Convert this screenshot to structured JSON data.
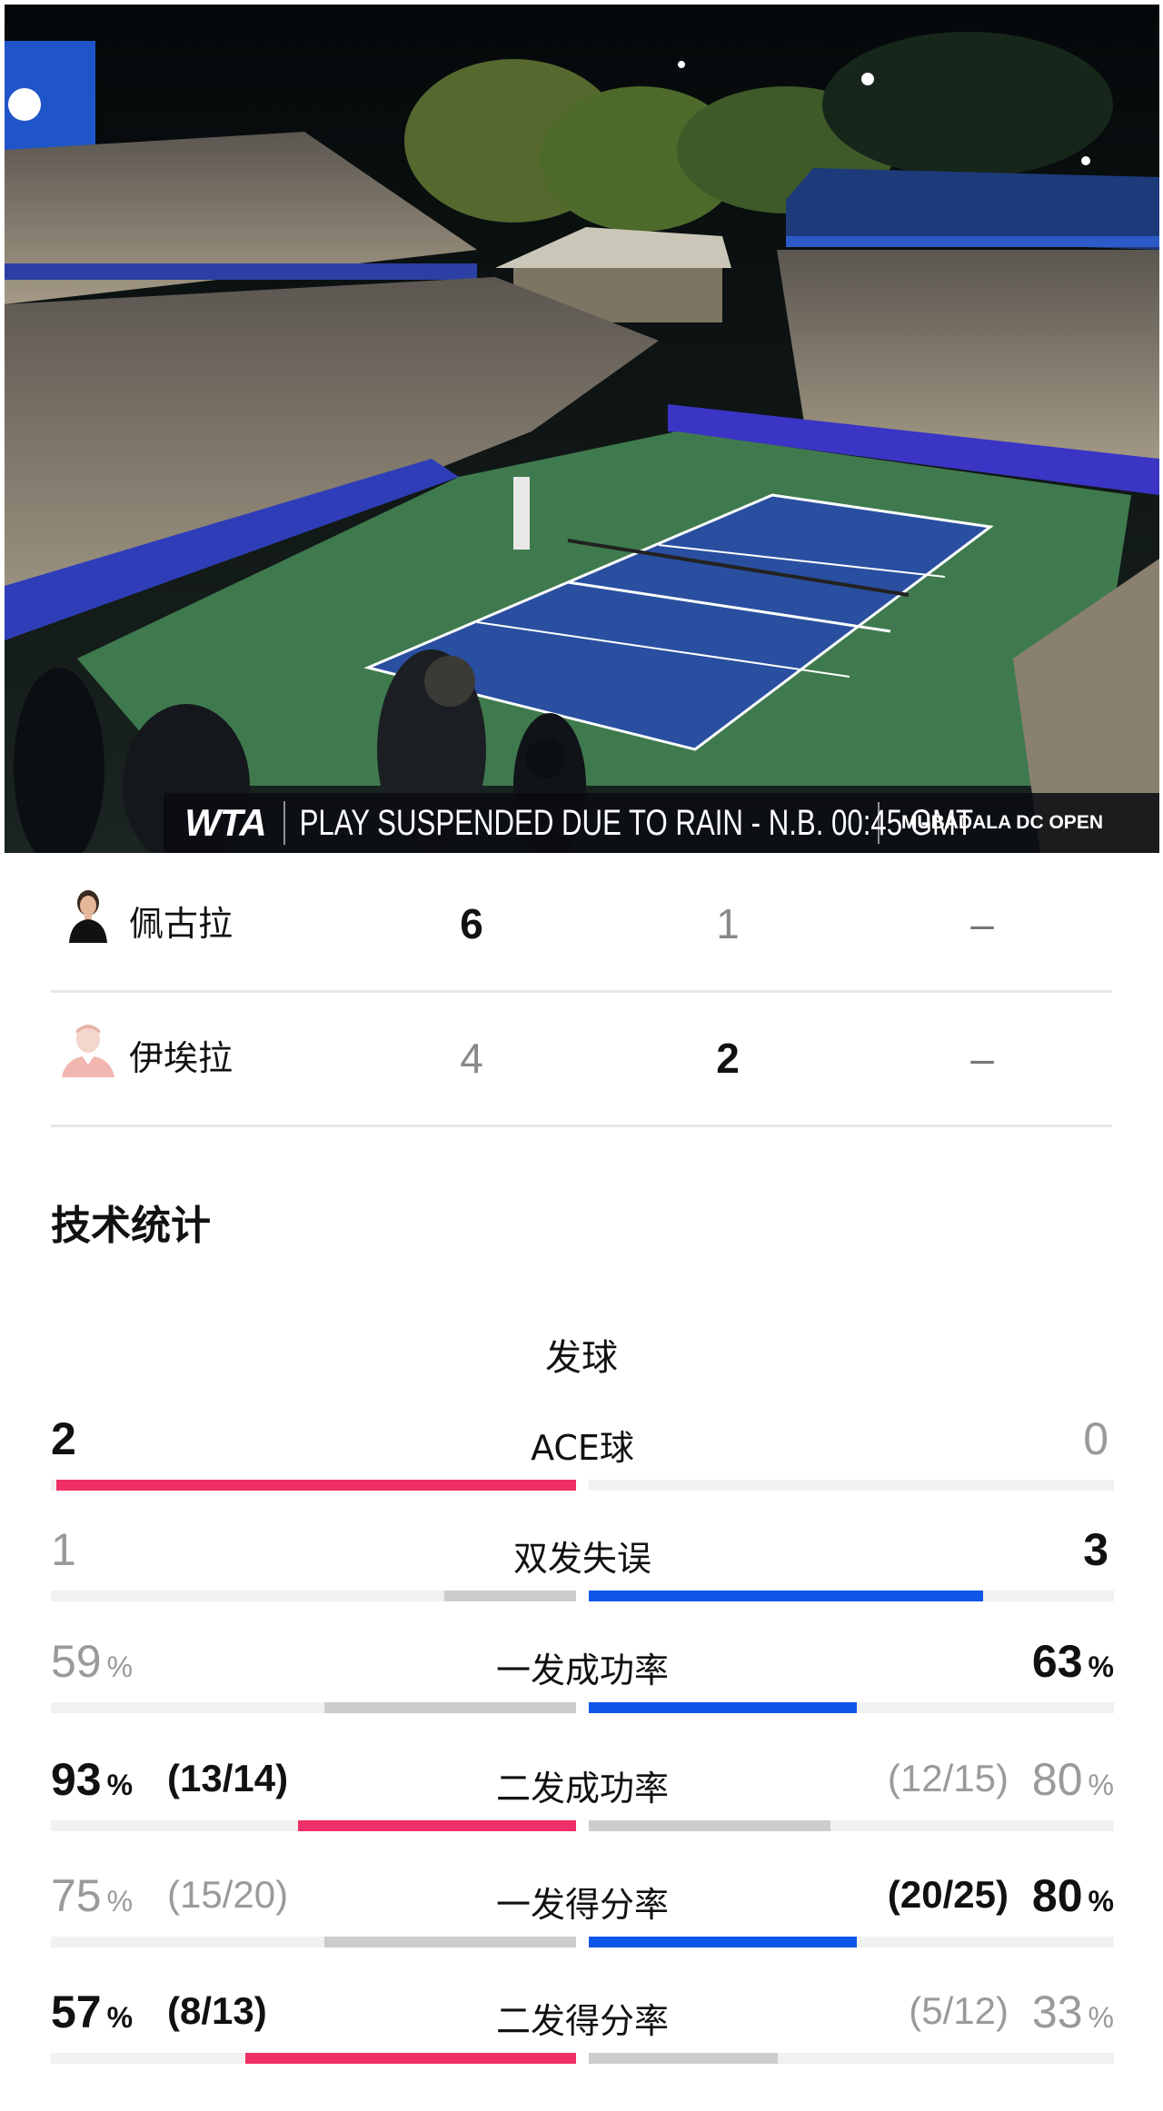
{
  "banner": {
    "logo": "WTA",
    "message": "PLAY SUSPENDED DUE TO RAIN - N.B. 00:45 GMT",
    "tournament": "MUBADALA DC OPEN"
  },
  "players": [
    {
      "name": "佩古拉",
      "sets": [
        "6",
        "1",
        "–"
      ],
      "avatar": "player-photo-icon"
    },
    {
      "name": "伊埃拉",
      "sets": [
        "4",
        "2",
        "–"
      ],
      "avatar": "player-placeholder-icon"
    }
  ],
  "stats_title": "技术统计",
  "serve_section": "发球",
  "stats": [
    {
      "label": "ACE球",
      "left": "2",
      "right": "0",
      "left_pct": "",
      "right_pct": "",
      "left_frac": "",
      "right_frac": "",
      "left_fill": 0.99,
      "right_fill": 0.0,
      "left_color": "#ef2f68",
      "right_color": "#cccccc",
      "winner": "left"
    },
    {
      "label": "双发失误",
      "left": "1",
      "right": "3",
      "left_pct": "",
      "right_pct": "",
      "left_frac": "",
      "right_frac": "",
      "left_fill": 0.25,
      "right_fill": 0.75,
      "left_color": "#cccccc",
      "right_color": "#0f55e8",
      "winner": "right"
    },
    {
      "label": "一发成功率",
      "left": "59",
      "right": "63",
      "left_pct": "%",
      "right_pct": "%",
      "left_frac": "",
      "right_frac": "",
      "left_fill": 0.48,
      "right_fill": 0.51,
      "left_color": "#cccccc",
      "right_color": "#0f55e8",
      "winner": "right"
    },
    {
      "label": "二发成功率",
      "left": "93",
      "right": "80",
      "left_pct": "%",
      "right_pct": "%",
      "left_frac": "(13/14)",
      "right_frac": "(12/15)",
      "left_fill": 0.53,
      "right_fill": 0.46,
      "left_color": "#ef2f68",
      "right_color": "#cccccc",
      "winner": "left"
    },
    {
      "label": "一发得分率",
      "left": "75",
      "right": "80",
      "left_pct": "%",
      "right_pct": "%",
      "left_frac": "(15/20)",
      "right_frac": "(20/25)",
      "left_fill": 0.48,
      "right_fill": 0.51,
      "left_color": "#cccccc",
      "right_color": "#0f55e8",
      "winner": "right"
    },
    {
      "label": "二发得分率",
      "left": "57",
      "right": "33",
      "left_pct": "%",
      "right_pct": "%",
      "left_frac": "(8/13)",
      "right_frac": "(5/12)",
      "left_fill": 0.63,
      "right_fill": 0.36,
      "left_color": "#ef2f68",
      "right_color": "#cccccc",
      "winner": "left"
    }
  ],
  "colors": {
    "pink": "#ef2f68",
    "blue": "#0f55e8",
    "grey": "#cccccc",
    "court": "#2a4fa0",
    "grass": "#3f7a4e"
  }
}
